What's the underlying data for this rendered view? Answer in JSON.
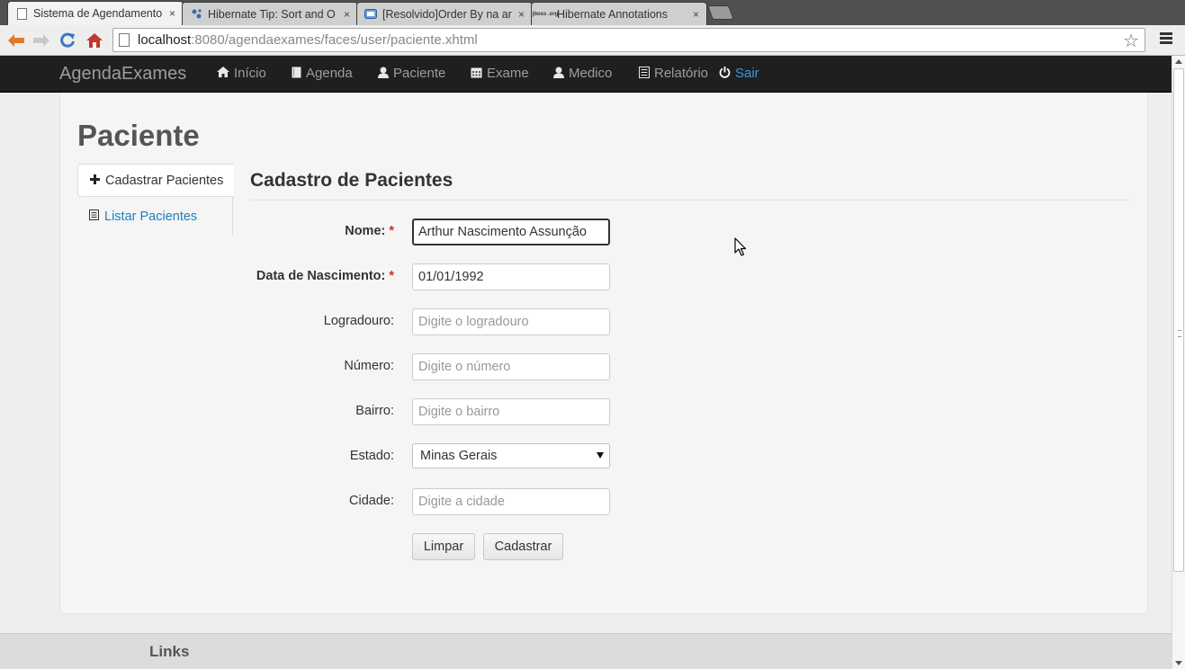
{
  "browser": {
    "tabs": [
      {
        "label": "Sistema de Agendamento",
        "close": "×",
        "favicon": "page-icon"
      },
      {
        "label": "Hibernate Tip: Sort and O",
        "close": "×",
        "favicon": "hibernate-icon"
      },
      {
        "label": "[Resolvido]Order By na ar",
        "close": "×",
        "favicon": "guj-icon"
      },
      {
        "label": "Hibernate Annotations",
        "close": "×",
        "favicon": "jboss-icon",
        "favicon_text": "jboss .org"
      }
    ],
    "url_host": "localhost",
    "url_rest": ":8080/agendaexames/faces/user/paciente.xhtml"
  },
  "navbar": {
    "brand": "AgendaExames",
    "items": [
      {
        "label": "Início",
        "icon": "home-icon"
      },
      {
        "label": "Agenda",
        "icon": "book-icon"
      },
      {
        "label": "Paciente",
        "icon": "user-icon"
      },
      {
        "label": "Exame",
        "icon": "calendar-icon"
      },
      {
        "label": "Medico",
        "icon": "user-icon"
      },
      {
        "label": "Relatório",
        "icon": "list-icon"
      },
      {
        "label": "Sair",
        "icon": "power-icon",
        "color": "#3a9ad9"
      }
    ]
  },
  "page": {
    "title": "Paciente",
    "sidenav": [
      {
        "label": "Cadastrar Pacientes",
        "icon": "plus-icon",
        "active": true
      },
      {
        "label": "Listar Pacientes",
        "icon": "list-icon",
        "active": false
      }
    ],
    "form_title": "Cadastro de Pacientes"
  },
  "form": {
    "nome": {
      "label": "Nome:",
      "required_mark": "*",
      "value": "Arthur Nascimento Assunção"
    },
    "nascimento": {
      "label": "Data de Nascimento:",
      "required_mark": "*",
      "value": "01/01/1992"
    },
    "logradouro": {
      "label": "Logradouro:",
      "placeholder": "Digite o logradouro",
      "value": ""
    },
    "numero": {
      "label": "Número:",
      "placeholder": "Digite o número",
      "value": ""
    },
    "bairro": {
      "label": "Bairro:",
      "placeholder": "Digite o bairro",
      "value": ""
    },
    "estado": {
      "label": "Estado:",
      "selected": "Minas Gerais"
    },
    "cidade": {
      "label": "Cidade:",
      "placeholder": "Digite a cidade",
      "value": ""
    },
    "limpar_label": "Limpar",
    "cadastrar_label": "Cadastrar"
  },
  "footer": {
    "links_title": "Links"
  },
  "colors": {
    "accent": "#3a9ad9",
    "navbar_bg": "#1f1f1f",
    "required": "#c9302c",
    "link": "#1f7fc0"
  }
}
